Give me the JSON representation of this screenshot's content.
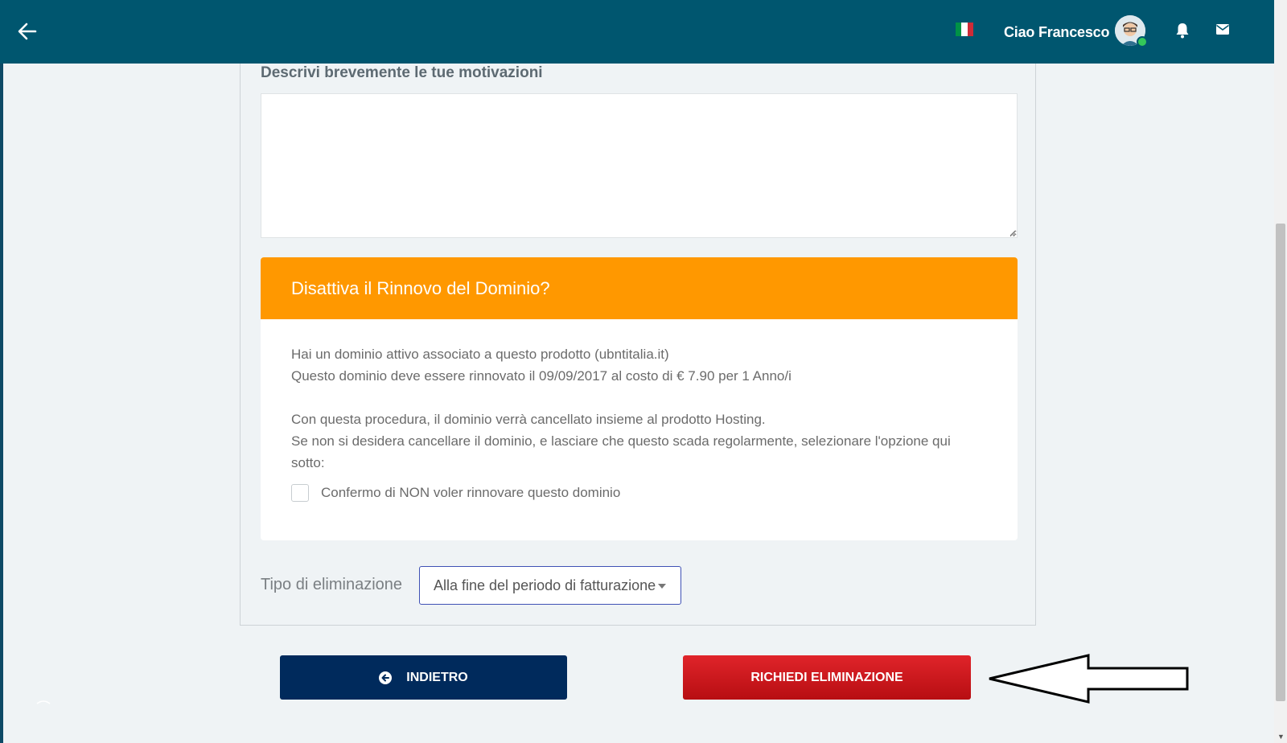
{
  "header": {
    "greeting": "Ciao Francesco",
    "icons": [
      "back-arrow-icon",
      "italy-flag-icon",
      "avatar",
      "bell-icon",
      "mail-icon"
    ]
  },
  "form": {
    "description_label": "Descrivi brevemente le tue motivazioni",
    "description_value": ""
  },
  "domain_card": {
    "title": "Disattiva il Rinnovo del Dominio?",
    "line1": "Hai un dominio attivo associato a questo prodotto (ubntitalia.it)",
    "line2": "Questo dominio deve essere rinnovato il 09/09/2017 al costo di € 7.90 per 1 Anno/i",
    "line3": "Con questa procedura, il dominio verrà cancellato insieme al prodotto Hosting.",
    "line4": "Se non si desidera cancellare il dominio, e lasciare che questo scada regolarmente, selezionare l'opzione qui sotto:",
    "checkbox_label": "Confermo di NON voler rinnovare questo dominio",
    "checkbox_checked": false
  },
  "elimination": {
    "label": "Tipo di eliminazione",
    "selected": "Alla fine del periodo di fatturazione"
  },
  "buttons": {
    "back": "INDIETRO",
    "delete": "RICHIEDI ELIMINAZIONE"
  },
  "colors": {
    "header_bg": "#00566f",
    "card_header": "#ff9800",
    "back_button": "#002a5c",
    "delete_button": "#c8161c"
  }
}
